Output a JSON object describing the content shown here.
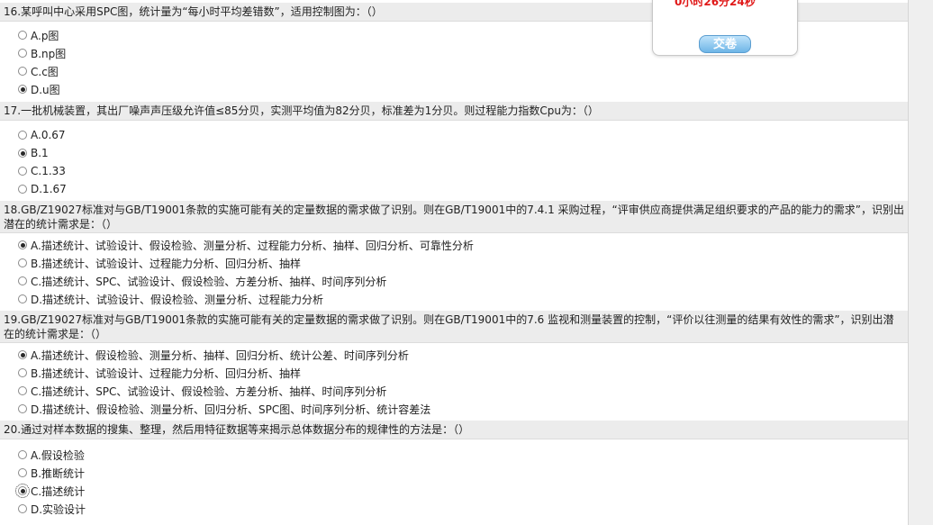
{
  "questions": [
    {
      "title": "16.某呼叫中心采用SPC图，统计量为“每小时平均差错数”，适用控制图为：（）",
      "options": [
        {
          "label": "A.p图",
          "checked": false
        },
        {
          "label": "B.np图",
          "checked": false
        },
        {
          "label": "C.c图",
          "checked": false
        },
        {
          "label": "D.u图",
          "checked": true
        }
      ]
    },
    {
      "title": "17.一批机械装置，其出厂噪声声压级允许值≤85分贝，实测平均值为82分贝，标准差为1分贝。则过程能力指数Cpu为：（）",
      "options": [
        {
          "label": "A.0.67",
          "checked": false
        },
        {
          "label": "B.1",
          "checked": true
        },
        {
          "label": "C.1.33",
          "checked": false
        },
        {
          "label": "D.1.67",
          "checked": false
        }
      ]
    },
    {
      "title": "18.GB/Z19027标准对与GB/T19001条款的实施可能有关的定量数据的需求做了识别。则在GB/T19001中的7.4.1 采购过程，“评审供应商提供满足组织要求的产品的能力的需求”，识别出潜在的统计需求是：（）",
      "options": [
        {
          "label": "A.描述统计、试验设计、假设检验、测量分析、过程能力分析、抽样、回归分析、可靠性分析",
          "checked": true
        },
        {
          "label": "B.描述统计、试验设计、过程能力分析、回归分析、抽样",
          "checked": false
        },
        {
          "label": "C.描述统计、SPC、试验设计、假设检验、方差分析、抽样、时间序列分析",
          "checked": false
        },
        {
          "label": "D.描述统计、试验设计、假设检验、测量分析、过程能力分析",
          "checked": false
        }
      ]
    },
    {
      "title": "19.GB/Z19027标准对与GB/T19001条款的实施可能有关的定量数据的需求做了识别。则在GB/T19001中的7.6 监视和测量装置的控制，“评价以往测量的结果有效性的需求”，识别出潜在的统计需求是：（）",
      "options": [
        {
          "label": "A.描述统计、假设检验、测量分析、抽样、回归分析、统计公差、时间序列分析",
          "checked": true
        },
        {
          "label": "B.描述统计、试验设计、过程能力分析、回归分析、抽样",
          "checked": false
        },
        {
          "label": "C.描述统计、SPC、试验设计、假设检验、方差分析、抽样、时间序列分析",
          "checked": false
        },
        {
          "label": "D.描述统计、假设检验、测量分析、回归分析、SPC图、时间序列分析、统计容差法",
          "checked": false
        }
      ]
    },
    {
      "title": "20.通过对样本数据的搜集、整理，然后用特征数据等来揭示总体数据分布的规律性的方法是：（）",
      "options": [
        {
          "label": "A.假设检验",
          "checked": false
        },
        {
          "label": "B.推断统计",
          "checked": false
        },
        {
          "label": "C.描述统计",
          "checked": true
        },
        {
          "label": "D.实验设计",
          "checked": false
        }
      ]
    }
  ],
  "timer": {
    "text": "0小时26分24秒"
  },
  "submit": {
    "label": "交卷"
  }
}
